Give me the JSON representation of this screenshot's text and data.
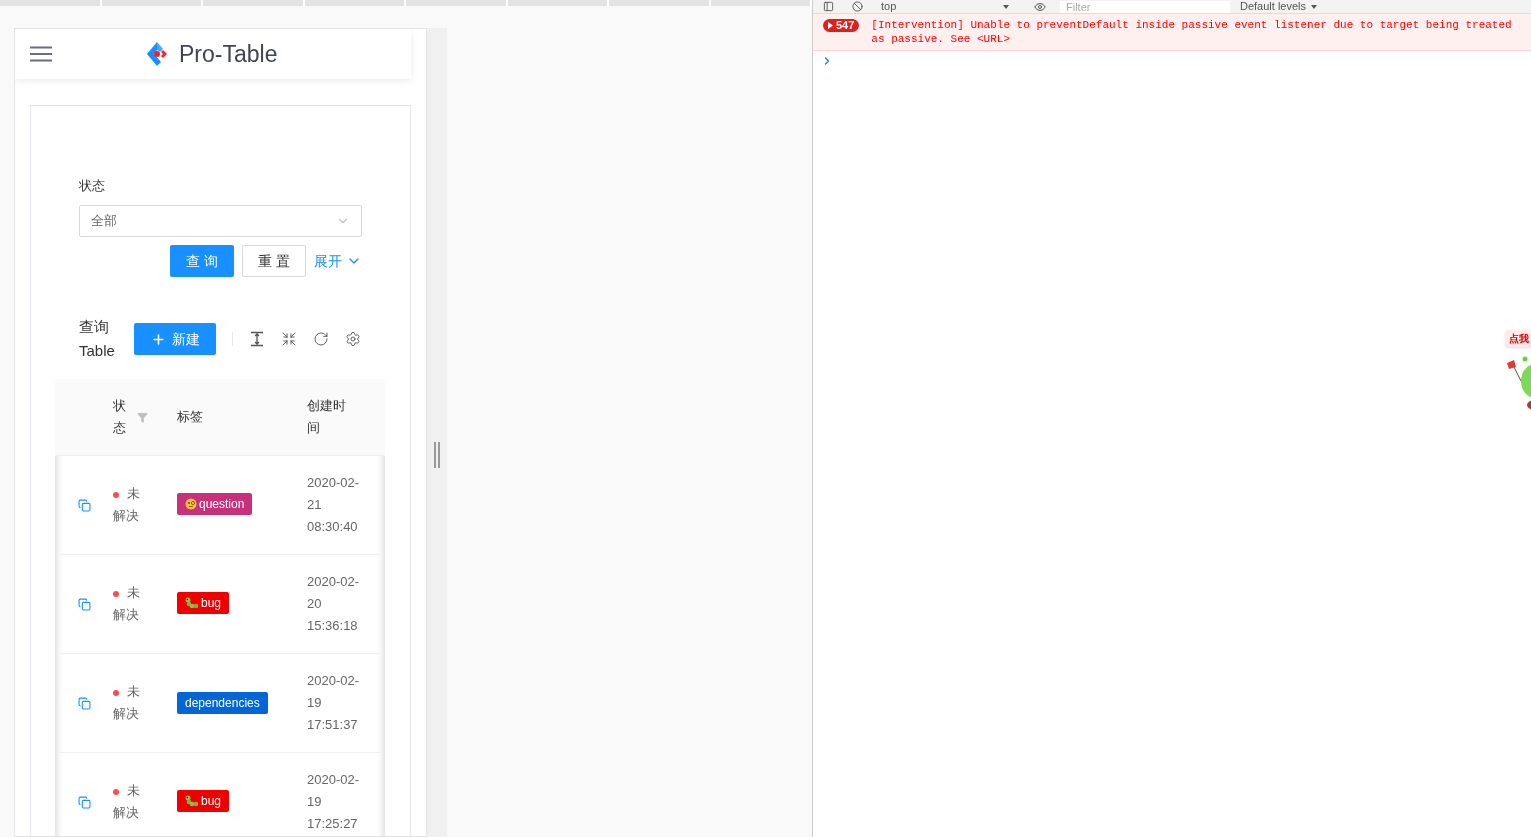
{
  "app": {
    "title": "Pro-Table",
    "search": {
      "label": "状态",
      "select_value": "全部",
      "buttons": [
        {
          "label": "查 询",
          "kind": "primary"
        },
        {
          "label": "重 置",
          "kind": "default"
        }
      ],
      "expand": "展开"
    },
    "toolbar": {
      "title": "查询 Table",
      "new_button": "新建"
    },
    "table": {
      "columns": [
        {
          "label": "状态",
          "kind": "filterable"
        },
        {
          "label": "标签",
          "kind": "plain"
        },
        {
          "label": "创建时间",
          "kind": "plain"
        }
      ],
      "rows": [
        {
          "status": "未解决",
          "color": "#ff4d4f",
          "tag": {
            "label": "question",
            "kind": "question",
            "color": "#c9307c"
          },
          "created": "2020-02-21 08:30:40"
        },
        {
          "status": "未解决",
          "color": "#ff4d4f",
          "tag": {
            "label": "bug",
            "kind": "bug",
            "color": "#ee0000"
          },
          "created": "2020-02-20 15:36:18"
        },
        {
          "status": "未解决",
          "color": "#ff4d4f",
          "tag": {
            "label": "dependencies",
            "kind": "plain",
            "color": "#0366d6"
          },
          "created": "2020-02-19 17:51:37"
        },
        {
          "status": "未解决",
          "color": "#ff4d4f",
          "tag": {
            "label": "bug",
            "kind": "bug",
            "color": "#ee0000"
          },
          "created": "2020-02-19 17:25:27"
        }
      ]
    }
  },
  "devtools": {
    "toolbar": {
      "context": "top",
      "filter_placeholder": "Filter",
      "levels": "Default levels"
    },
    "messages": [
      {
        "kind": "error",
        "count": "547",
        "text": "[Intervention] Unable to preventDefault inside passive event listener due to target being treated as passive. See <URL>"
      }
    ]
  },
  "promo": {
    "bubble": "点我"
  }
}
